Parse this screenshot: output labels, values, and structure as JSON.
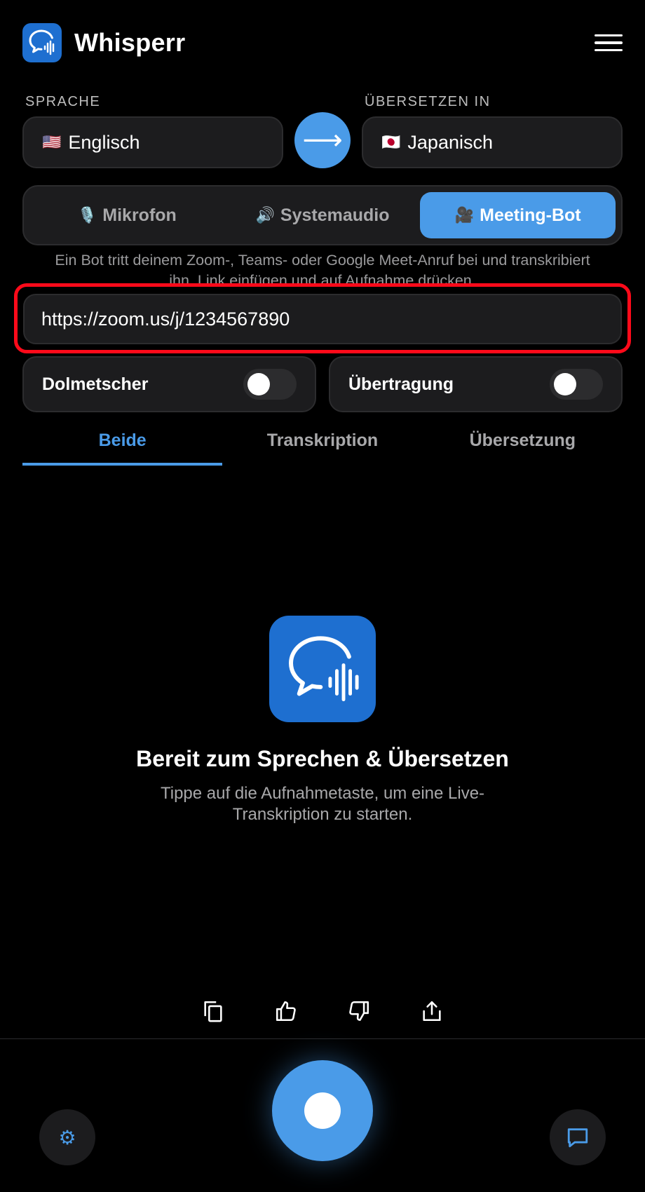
{
  "header": {
    "title": "Whisperr",
    "logo_icon": "speech-bubble-waveform-icon",
    "menu_icon": "hamburger-menu-icon"
  },
  "language": {
    "source_label": "SPRACHE",
    "source_flag": "🇺🇸",
    "source_value": "Englisch",
    "target_label": "ÜBERSETZEN IN",
    "target_flag": "🇯🇵",
    "target_value": "Japanisch",
    "swap_symbol": "⟶"
  },
  "source_tabs": [
    {
      "emoji": "🎙️",
      "label": "Mikrofon",
      "active": false
    },
    {
      "emoji": "🔊",
      "label": "Systemaudio",
      "active": false
    },
    {
      "emoji": "🎥",
      "label": "Meeting-Bot",
      "active": true
    }
  ],
  "meeting_bot": {
    "description": "Ein Bot tritt deinem Zoom-, Teams- oder Google Meet-Anruf bei und transkribiert ihn. Link einfügen und auf Aufnahme drücken.",
    "url_value": "https://zoom.us/j/1234567890"
  },
  "toggles": [
    {
      "label": "Dolmetscher",
      "on": false
    },
    {
      "label": "Übertragung",
      "on": false
    }
  ],
  "view_tabs": [
    {
      "label": "Beide",
      "active": true
    },
    {
      "label": "Transkription",
      "active": false
    },
    {
      "label": "Übersetzung",
      "active": false
    }
  ],
  "empty_state": {
    "title": "Bereit zum Sprechen & Übersetzen",
    "subtitle": "Tippe auf die Aufnahmetaste, um eine Live-Transkription zu starten."
  },
  "actions": [
    "copy-icon",
    "thumbs-up-icon",
    "thumbs-down-icon",
    "share-icon"
  ],
  "bottom": {
    "settings_glyph": "⚙"
  },
  "colors": {
    "accent": "#4a9be8",
    "logo_bg": "#1e6fd0",
    "highlight": "#ff0a1a",
    "card_bg": "#1c1c1e"
  }
}
